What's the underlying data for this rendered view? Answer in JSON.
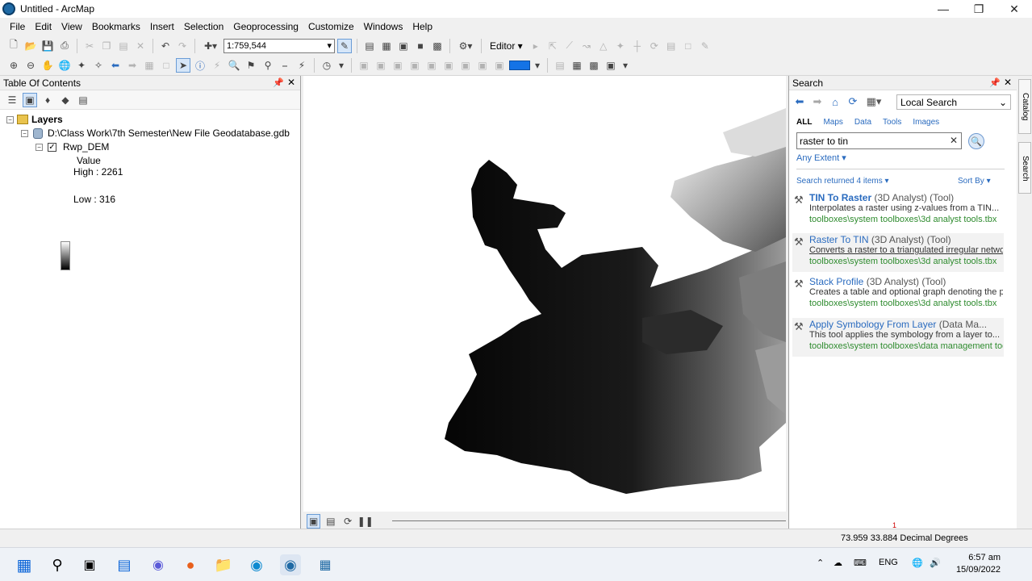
{
  "window": {
    "title": "Untitled - ArcMap"
  },
  "menu": [
    "File",
    "Edit",
    "View",
    "Bookmarks",
    "Insert",
    "Selection",
    "Geoprocessing",
    "Customize",
    "Windows",
    "Help"
  ],
  "toolbar": {
    "scale": "1:759,544",
    "editor_label": "Editor ▾"
  },
  "toc": {
    "title": "Table Of Contents",
    "root": "Layers",
    "database": "D:\\Class Work\\7th Semester\\New File Geodatabase.gdb",
    "layer": "Rwp_DEM",
    "legend_heading": "Value",
    "high": "High : 2261",
    "low": "Low : 316"
  },
  "search": {
    "title": "Search",
    "scope": "Local Search",
    "tabs": [
      "ALL",
      "Maps",
      "Data",
      "Tools",
      "Images"
    ],
    "query": "raster to tin",
    "extent": "Any Extent ▾",
    "returned": "Search returned 4 items ▾",
    "sort": "Sort By ▾",
    "results": [
      {
        "name": "TIN To Raster",
        "meta": " (3D Analyst) (Tool)",
        "desc": "Interpolates a raster using z-values from a TIN...",
        "path": "toolboxes\\system toolboxes\\3d analyst tools.tbx"
      },
      {
        "name": "Raster To TIN",
        "meta": " (3D Analyst) (Tool)",
        "desc": "Converts a raster to a triangulated irregular network",
        "path": "toolboxes\\system toolboxes\\3d analyst tools.tbx"
      },
      {
        "name": "Stack Profile",
        "meta": " (3D Analyst) (Tool)",
        "desc": "Creates a table and optional graph denoting the profile...",
        "path": "toolboxes\\system toolboxes\\3d analyst tools.tbx"
      },
      {
        "name": "Apply Symbology From Layer",
        "meta": " (Data Ma...",
        "desc": "This tool applies the symbology from a layer to...",
        "path": "toolboxes\\system toolboxes\\data management tools.tbx"
      }
    ]
  },
  "sidetabs": [
    "Catalog",
    "Search"
  ],
  "status": {
    "coords": "73.959  33.884 Decimal Degrees",
    "marker": "1"
  },
  "taskbar": {
    "lang": "ENG",
    "time": "6:57 am",
    "date": "15/09/2022"
  }
}
